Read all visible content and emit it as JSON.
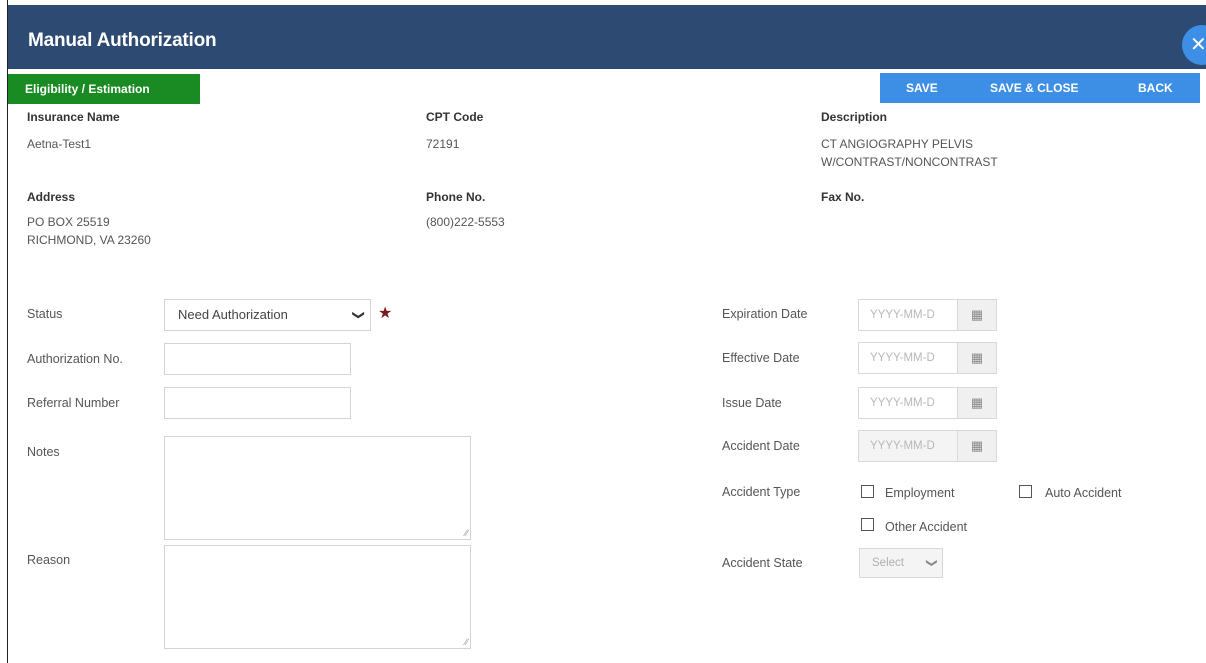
{
  "dialog": {
    "title": "Manual Authorization",
    "close_glyph": "✕"
  },
  "tab": {
    "label": "Eligibility / Estimation"
  },
  "toolbar": {
    "save": "SAVE",
    "save_close": "SAVE & CLOSE",
    "back": "BACK"
  },
  "info": {
    "insurance_name_label": "Insurance Name",
    "insurance_name": "Aetna-Test1",
    "cpt_code_label": "CPT Code",
    "cpt_code": "72191",
    "description_label": "Description",
    "description_line1": "CT ANGIOGRAPHY PELVIS",
    "description_line2": "W/CONTRAST/NONCONTRAST",
    "address_label": "Address",
    "address_line1": "PO BOX 25519",
    "address_line2": "RICHMOND, VA 23260",
    "phone_label": "Phone No.",
    "phone": "(800)222-5553",
    "fax_label": "Fax No."
  },
  "form": {
    "status_label": "Status",
    "status_value": "Need Authorization",
    "auth_no_label": "Authorization No.",
    "referral_label": "Referral Number",
    "notes_label": "Notes",
    "reason_label": "Reason",
    "expiration_label": "Expiration Date",
    "effective_label": "Effective Date",
    "issue_label": "Issue Date",
    "accident_date_label": "Accident Date",
    "date_placeholder": "YYYY-MM-D",
    "accident_type_label": "Accident Type",
    "accident_types": [
      "Employment",
      "Auto Accident",
      "Other Accident"
    ],
    "accident_state_label": "Accident State",
    "accident_state_value": "Select"
  },
  "icons": {
    "calendar": "calendar-icon",
    "chevron": "chevron-down-icon",
    "required": "required-star-icon",
    "close": "close-icon"
  },
  "colors": {
    "header": "#2c4a72",
    "tab": "#1a8a23",
    "toolbar": "#3d8fe6",
    "required": "#7a1a1a"
  }
}
